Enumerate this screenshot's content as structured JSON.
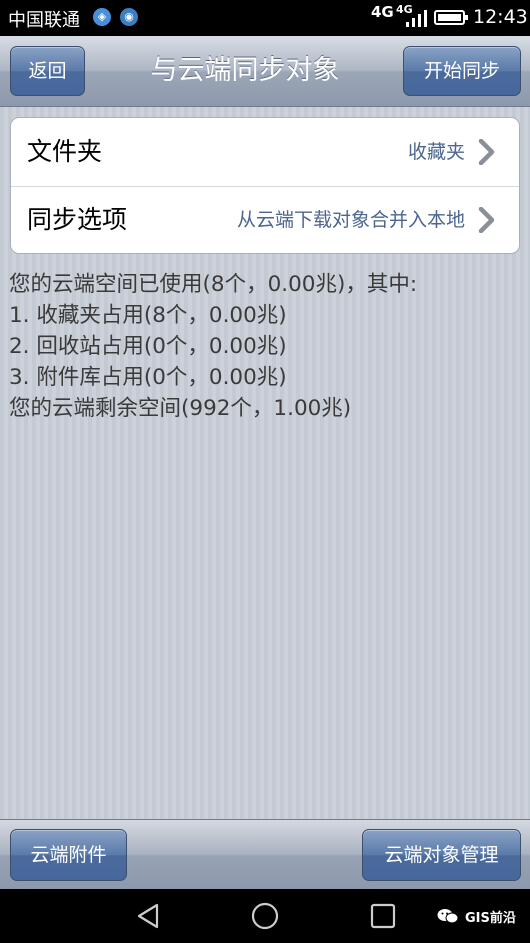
{
  "status_bar": {
    "carrier": "中国联通",
    "network_type": "4G",
    "network_type_small": "4G",
    "time": "12:43",
    "icons": [
      "shield-notification-icon",
      "browser-notification-icon",
      "signal-icon",
      "battery-icon"
    ]
  },
  "header": {
    "back_label": "返回",
    "title": "与云端同步对象",
    "start_sync_label": "开始同步"
  },
  "settings": {
    "rows": [
      {
        "label": "文件夹",
        "value": "收藏夹"
      },
      {
        "label": "同步选项",
        "value": "从云端下载对象合并入本地"
      }
    ]
  },
  "storage_info": {
    "lines": [
      "您的云端空间已使用(8个，0.00兆)，其中:",
      "1. 收藏夹占用(8个，0.00兆)",
      "2. 回收站占用(0个，0.00兆)",
      "3. 附件库占用(0个，0.00兆)",
      "您的云端剩余空间(992个，1.00兆)"
    ]
  },
  "toolbar": {
    "attachments_label": "云端附件",
    "manage_label": "云端对象管理"
  },
  "watermark": {
    "text": "GIS前沿"
  },
  "colors": {
    "accent_button": "#4b6b9c",
    "value_text": "#4c6690",
    "background": "#c9ced6"
  }
}
